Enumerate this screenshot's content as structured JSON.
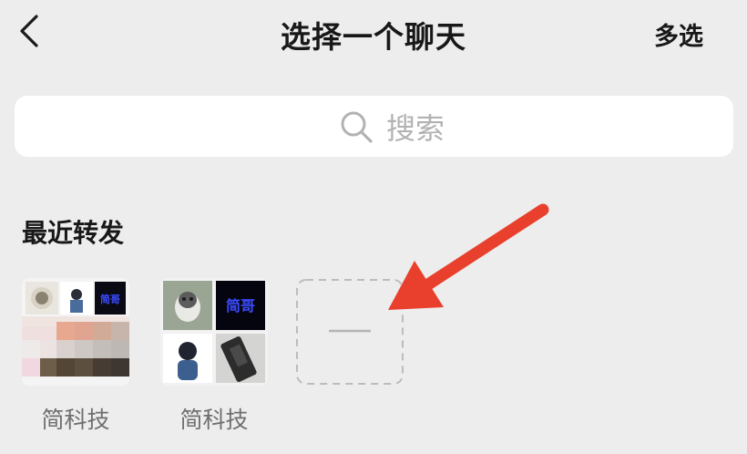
{
  "nav": {
    "back_icon": "chevron-left-icon",
    "title": "选择一个聊天",
    "multi_select": "多选"
  },
  "search": {
    "icon": "search-icon",
    "placeholder": "搜索"
  },
  "recent": {
    "title": "最近转发",
    "chats": [
      {
        "name": "简科技"
      },
      {
        "name": "简科技"
      }
    ],
    "add_slot_icon": "dash-icon"
  },
  "annotation": {
    "type": "arrow",
    "color": "#e8402c"
  }
}
